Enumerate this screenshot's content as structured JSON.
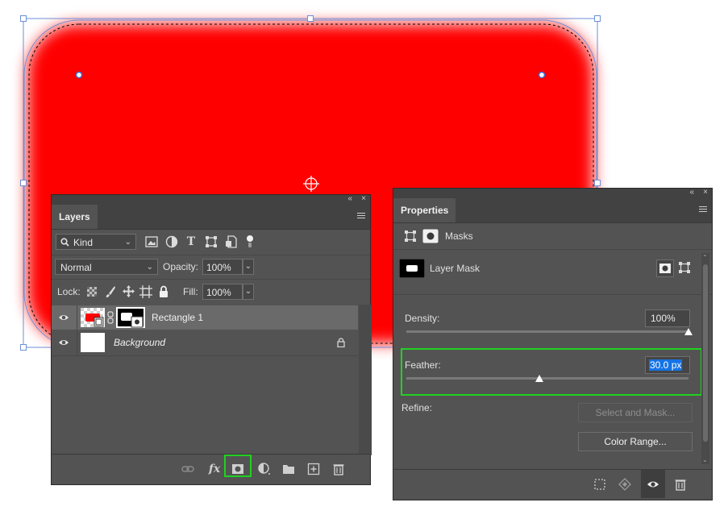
{
  "layers_panel": {
    "tab_label": "Layers",
    "collapse_glyph": "«",
    "close_glyph": "×",
    "filter": {
      "kind_label": "Kind",
      "icons": [
        "image-filter-icon",
        "adjustment-filter-icon",
        "type-filter-icon",
        "shape-filter-icon",
        "smart-object-filter-icon",
        "filter-toggle-icon"
      ]
    },
    "blend_mode": "Normal",
    "opacity_label": "Opacity:",
    "opacity_value": "100%",
    "lock_label": "Lock:",
    "fill_label": "Fill:",
    "fill_value": "100%",
    "layers": [
      {
        "name": "Rectangle 1",
        "selected": true
      },
      {
        "name": "Background",
        "selected": false,
        "locked": true
      }
    ],
    "bottom_icons": [
      "link-layers-icon",
      "fx-icon",
      "add-mask-icon",
      "adjustment-layer-icon",
      "new-group-icon",
      "new-layer-icon",
      "delete-layer-icon"
    ],
    "fx_label": "fx"
  },
  "properties_panel": {
    "tab_label": "Properties",
    "collapse_glyph": "«",
    "close_glyph": "×",
    "section_label": "Masks",
    "mask_label": "Layer Mask",
    "density_label": "Density:",
    "density_value": "100%",
    "density_fraction": 1.0,
    "feather_label": "Feather:",
    "feather_value": "30.0 px",
    "feather_fraction": 0.47,
    "refine_label": "Refine:",
    "select_and_mask_label": "Select and Mask...",
    "color_range_label": "Color Range...",
    "bottom_icons": [
      "load-selection-icon",
      "apply-mask-icon",
      "mask-visibility-icon",
      "delete-mask-icon"
    ]
  },
  "colors": {
    "shape_fill": "#ff0000",
    "panel_bg": "#535353",
    "highlight": "#21d121",
    "selection_bg": "#1473e6"
  }
}
